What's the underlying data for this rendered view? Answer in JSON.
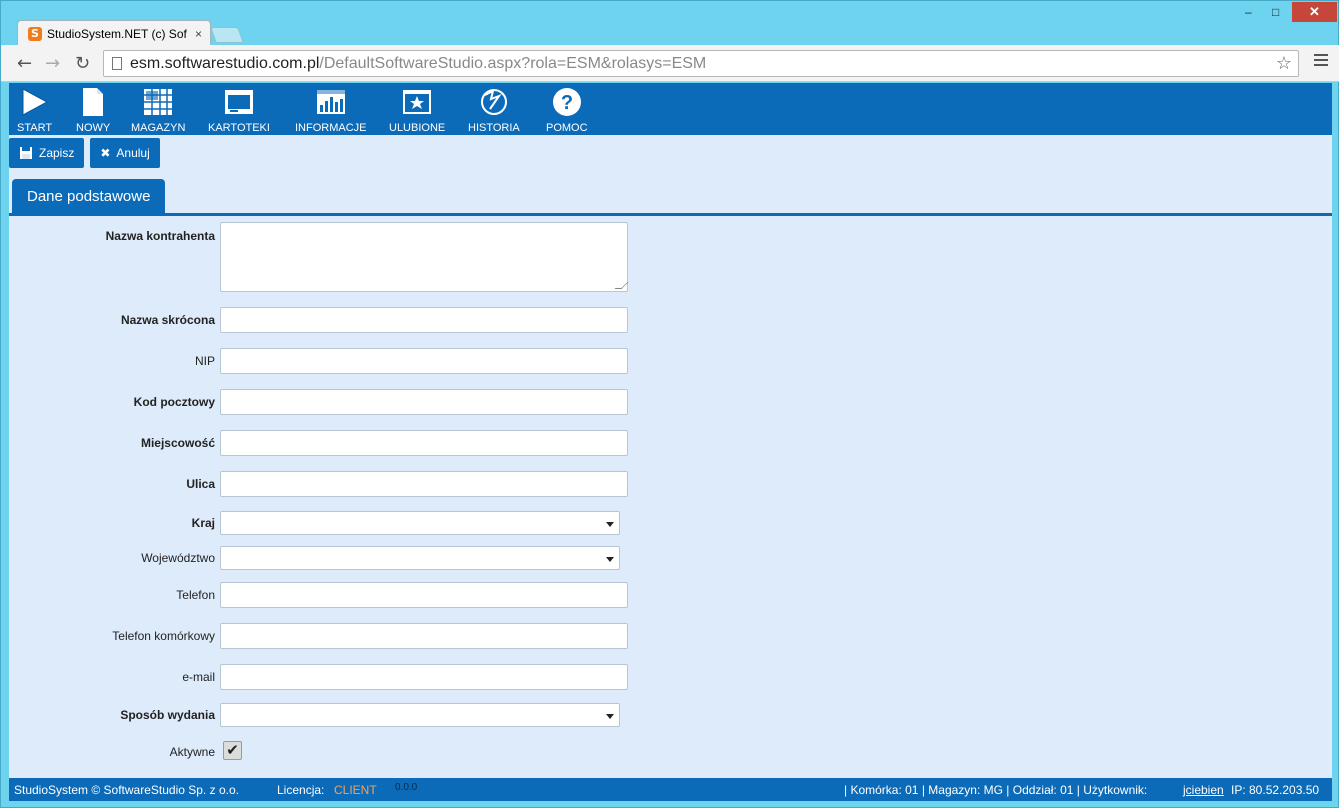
{
  "browser": {
    "tab_title": "StudioSystem.NET (c) Soft",
    "tab_close": "×",
    "favicon_letter": "S",
    "url_host": "esm.softwarestudio.com.pl",
    "url_path": "/DefaultSoftwareStudio.aspx?rola=ESM&rolasys=ESM",
    "minimize": "‒",
    "maximize": "□",
    "close": "✕"
  },
  "appnav": {
    "items": [
      {
        "label": "START",
        "icon": "play-icon"
      },
      {
        "label": "NOWY",
        "icon": "document-icon"
      },
      {
        "label": "MAGAZYN",
        "icon": "grid-icon"
      },
      {
        "label": "KARTOTEKI",
        "icon": "window-icon"
      },
      {
        "label": "INFORMACJE",
        "icon": "chart-icon"
      },
      {
        "label": "ULUBIONE",
        "icon": "star-icon"
      },
      {
        "label": "HISTORIA",
        "icon": "globe-icon"
      },
      {
        "label": "POMOC",
        "icon": "help-icon"
      }
    ]
  },
  "actions": {
    "save_label": "Zapisz",
    "cancel_label": "Anuluj"
  },
  "tabs": {
    "active_label": "Dane podstawowe"
  },
  "form": {
    "nazwa_kontrahenta": "Nazwa kontrahenta",
    "nazwa_skrocona": "Nazwa skrócona",
    "nip": "NIP",
    "kod_pocztowy": "Kod pocztowy",
    "miejscowosc": "Miejscowość",
    "ulica": "Ulica",
    "kraj": "Kraj",
    "wojewodztwo": "Województwo",
    "telefon": "Telefon",
    "telefon_komorkowy": "Telefon komórkowy",
    "email": "e-mail",
    "sposob_wydania": "Sposób wydania",
    "aktywne": "Aktywne",
    "aktywne_checked": "✔"
  },
  "status": {
    "copyright": "StudioSystem © SoftwareStudio Sp. z o.o.",
    "licencja_label": "Licencja:",
    "licencja_value": "CLIENT",
    "version": "0.0.0",
    "right_prefix": "| Komórka: 01 | Magazyn: MG | Oddział: 01 | Użytkownik:",
    "user": "jciebien",
    "ip": "IP: 80.52.203.50"
  },
  "colors": {
    "accent": "#0c6bb8",
    "page_bg": "#deebfb",
    "licence_highlight": "#f7a15a"
  }
}
